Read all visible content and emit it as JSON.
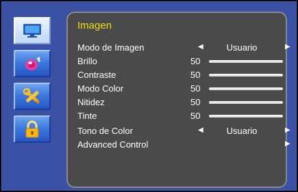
{
  "menu": {
    "title": "Imagen",
    "sidebar": [
      {
        "icon": "monitor-icon",
        "active": true
      },
      {
        "icon": "speaker-icon",
        "active": false
      },
      {
        "icon": "tools-icon",
        "active": false
      },
      {
        "icon": "lock-icon",
        "active": false
      }
    ],
    "rows": {
      "picture_mode": {
        "label": "Modo de Imagen",
        "value": "Usuario"
      },
      "brightness": {
        "label": "Brillo",
        "value": "50",
        "level": 1.0
      },
      "contrast": {
        "label": "Contraste",
        "value": "50",
        "level": 1.0
      },
      "color": {
        "label": "Modo Color",
        "value": "50",
        "level": 1.0
      },
      "sharpness": {
        "label": "Nitidez",
        "value": "50",
        "level": 1.0
      },
      "tint": {
        "label": "Tinte",
        "value": "50",
        "level": 1.0
      },
      "color_tone": {
        "label": "Tono de Color",
        "value": "Usuario"
      },
      "advanced": {
        "label": "Advanced Control"
      }
    }
  },
  "colors": {
    "frame": "#3a51a6",
    "panel": "#4a4a4a",
    "title": "#f1de18",
    "text": "#ffffff"
  }
}
